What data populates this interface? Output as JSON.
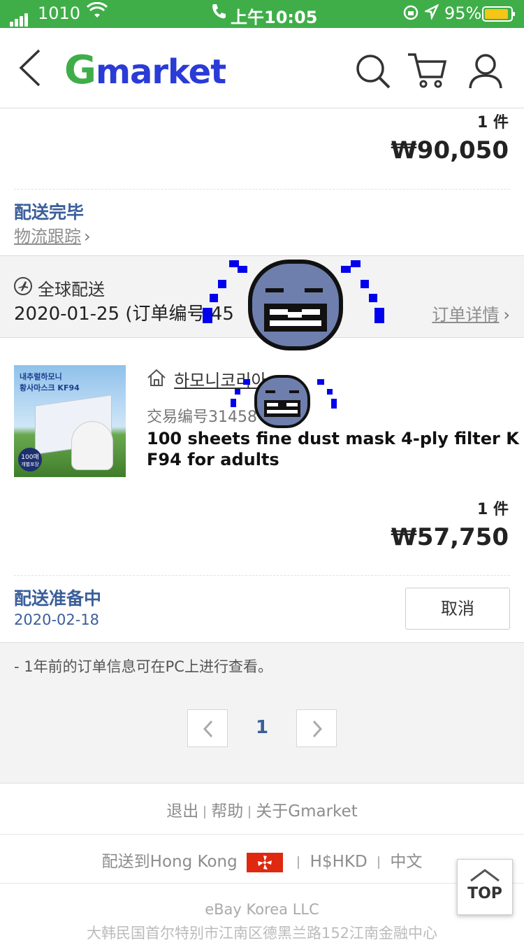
{
  "status_bar": {
    "carrier": "1010",
    "time": "上午10:05",
    "battery": "95%"
  },
  "header": {
    "logo_g": "G",
    "logo_rest": "market"
  },
  "order_prev": {
    "qty": "1 件",
    "price": "₩90,050",
    "status": "配送完毕",
    "tracking": "物流跟踪"
  },
  "order_group": {
    "shipping_type": "全球配送",
    "date_order": "2020-01-25 (订单编号 45",
    "date_order_tail": ")",
    "details_link": "订单详情"
  },
  "item": {
    "seller": "하모니코리아",
    "trade_no": "交易编号31458",
    "title_line1": "100 sheets fine dust mask 4-ply filter K",
    "title_line2": "F94 for adults",
    "image_text1": "내추럴하모니",
    "image_text2": "황사마스크 KF94",
    "image_badge": "100매",
    "image_badge2": "개별포장",
    "qty": "1 件",
    "price": "₩57,750",
    "status": "配送准备中",
    "status_date": "2020-02-18",
    "cancel_label": "取消"
  },
  "notice": "- 1年前的订单信息可在PC上进行查看。",
  "pagination": {
    "current": "1"
  },
  "footer": {
    "links": [
      "退出",
      "帮助",
      "关于Gmarket"
    ],
    "ship_to": "配送到Hong Kong",
    "currency": "H$HKD",
    "language": "中文",
    "company": "eBay Korea LLC",
    "address": "大韩民国首尔特别市江南区德黑兰路152江南金融中心",
    "top_label": "TOP"
  },
  "colors": {
    "brand_green": "#3fae49",
    "brand_blue": "#2a3bd6",
    "status_blue": "#3b5f9a"
  }
}
